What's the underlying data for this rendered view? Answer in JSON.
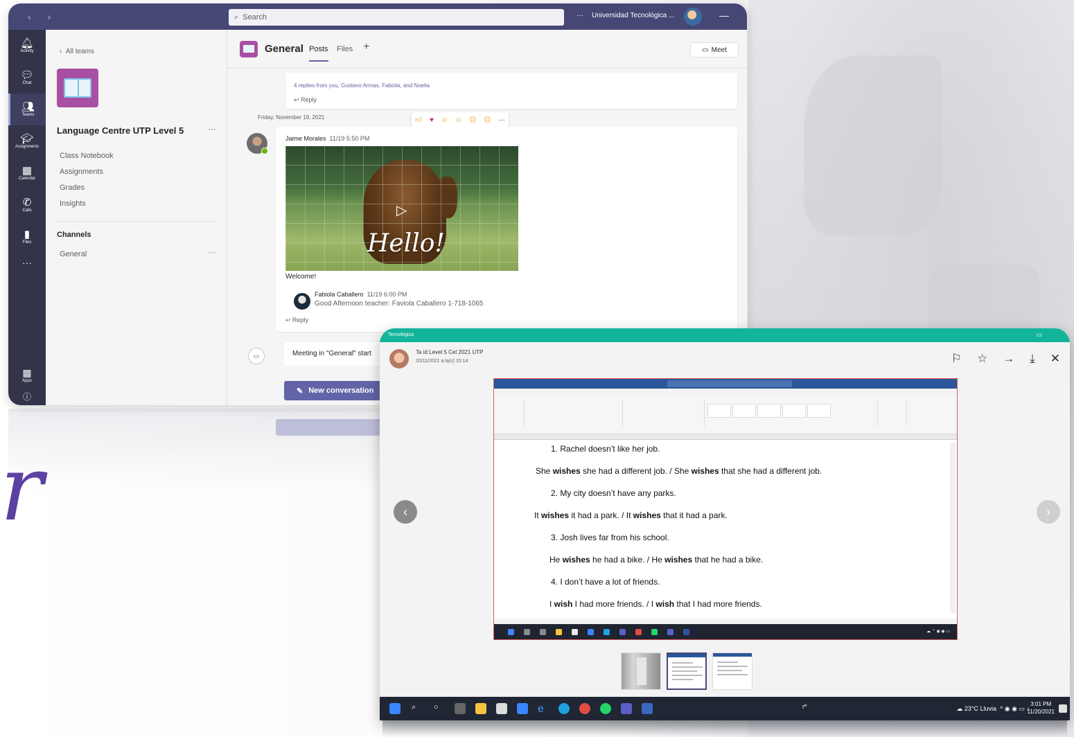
{
  "teams": {
    "search_placeholder": "Search",
    "org_name": "Universidad Tecnológica ...",
    "more": "···",
    "rail": [
      {
        "label": "Activity",
        "icon": "bell-icon"
      },
      {
        "label": "Chat",
        "icon": "chat-icon"
      },
      {
        "label": "Teams",
        "icon": "teams-icon"
      },
      {
        "label": "Assignments",
        "icon": "assignments-icon"
      },
      {
        "label": "Calendar",
        "icon": "calendar-icon"
      },
      {
        "label": "Calls",
        "icon": "phone-icon"
      },
      {
        "label": "Files",
        "icon": "file-icon"
      }
    ],
    "rail_more": "···",
    "rail_apps": "Apps",
    "panel": {
      "back": "All teams",
      "team_name": "Language Centre UTP Level 5",
      "team_more": "···",
      "links": [
        "Class Notebook",
        "Assignments",
        "Grades",
        "Insights"
      ],
      "channels_heading": "Channels",
      "channel": "General",
      "channel_more": "···"
    },
    "channel": {
      "title": "General",
      "tabs": [
        "Posts",
        "Files"
      ],
      "add_tab": "+",
      "meet": "Meet",
      "replies": "4 replies from you, Gustavo Armas, Fabiola, and Noelia",
      "reply": "Reply",
      "date": "Friday, November 19, 2021",
      "post_author": "Jaime Morales",
      "post_time": "11/19 5:50 PM",
      "gif_text": "Hello!",
      "post_message": "Welcome!",
      "reply_author": "Fabiola Caballero",
      "reply_time": "11/19 6:00 PM",
      "reply_message": "Good Afternoon teacher: Faviola Caballero 1-718-1065",
      "reply2": "Reply",
      "meeting": "Meeting in \"General\" start",
      "new_conversation": "New conversation"
    }
  },
  "viewer": {
    "topbar_label": "Tecnológica",
    "sender": "Ta id Level 5 Cel 2021 UTP",
    "sent_time": "20/11/2021 a la(s) 15:14",
    "actions": [
      "flag-icon",
      "star-icon",
      "forward-icon",
      "download-icon",
      "close-icon"
    ],
    "document_lines": [
      {
        "num": "1.",
        "text": "Rachel doesn’t like her job."
      },
      {
        "pre": "She ",
        "b1": "wishes",
        "mid": " she had a different job. / She ",
        "b2": "wishes",
        "post": " that she had a different job."
      },
      {
        "num": "2.",
        "text": "My city doesn’t have any parks."
      },
      {
        "pre": "It ",
        "b1": "wishes",
        "mid": " it had a park. / It ",
        "b2": "wishes",
        "post": " that it had a park."
      },
      {
        "num": "3.",
        "text": "Josh lives far from his school."
      },
      {
        "pre": "He ",
        "b1": "wishes",
        "mid": " he had a bike. / He ",
        "b2": "wishes",
        "post": " that he had a bike."
      },
      {
        "num": "4.",
        "text": "I don’t have a lot of friends."
      },
      {
        "pre": "I ",
        "b1": "wish",
        "mid": " I had more friends. / I ",
        "b2": "wish",
        "post": " that I had more friends."
      }
    ],
    "taskbar_weather": "23°C Lluvia",
    "taskbar_time": "3:01 PM",
    "taskbar_date": "11/20/2021"
  },
  "colors": {
    "teams_purple": "#464775",
    "rail": "#33344a",
    "brand": "#6264a7",
    "viewer_accent": "#13b59a",
    "word_blue": "#2b579a"
  }
}
